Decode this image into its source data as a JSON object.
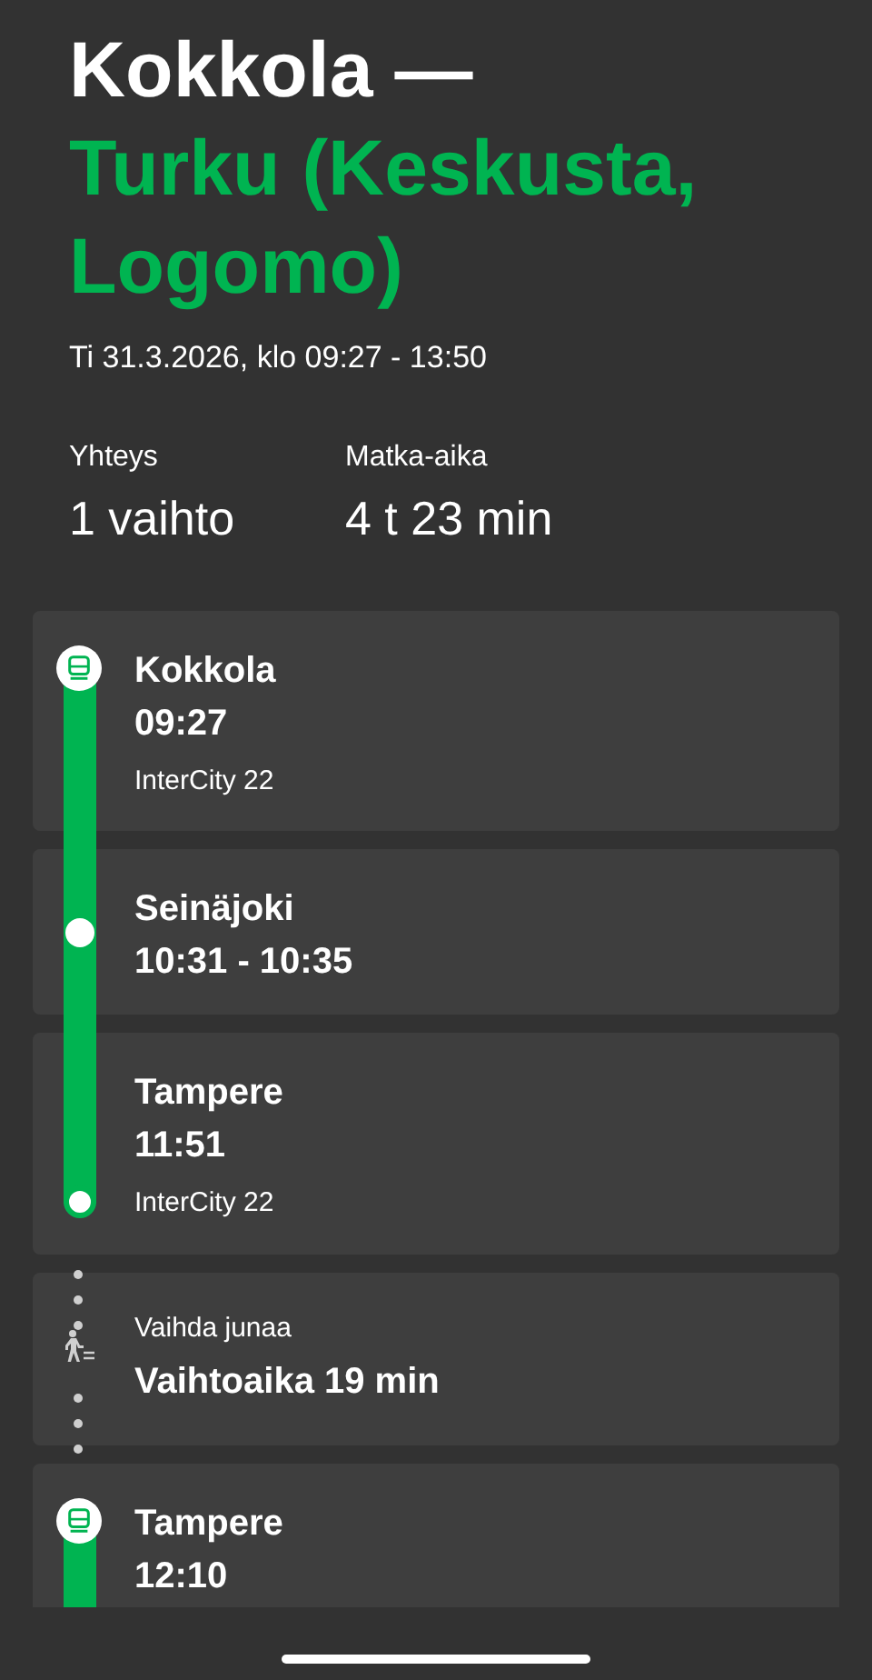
{
  "header": {
    "origin": "Kokkola —",
    "destination": "Turku (Keskusta, Logomo)",
    "date": "Ti 31.3.2026, klo 09:27 - 13:50"
  },
  "summary": [
    {
      "label": "Yhteys",
      "value": "1 vaihto"
    },
    {
      "label": "Matka-aika",
      "value": "4 t 23 min"
    }
  ],
  "legs": [
    {
      "kind": "board",
      "station": "Kokkola",
      "time": "09:27",
      "train": "InterCity 22"
    },
    {
      "kind": "pass",
      "station": "Seinäjoki",
      "time": "10:31 - 10:35"
    },
    {
      "kind": "alight",
      "station": "Tampere",
      "time": "11:51",
      "train": "InterCity 22"
    },
    {
      "kind": "transfer",
      "label": "Vaihda junaa",
      "time": "Vaihtoaika 19 min"
    },
    {
      "kind": "board",
      "station": "Tampere",
      "time": "12:10"
    }
  ]
}
